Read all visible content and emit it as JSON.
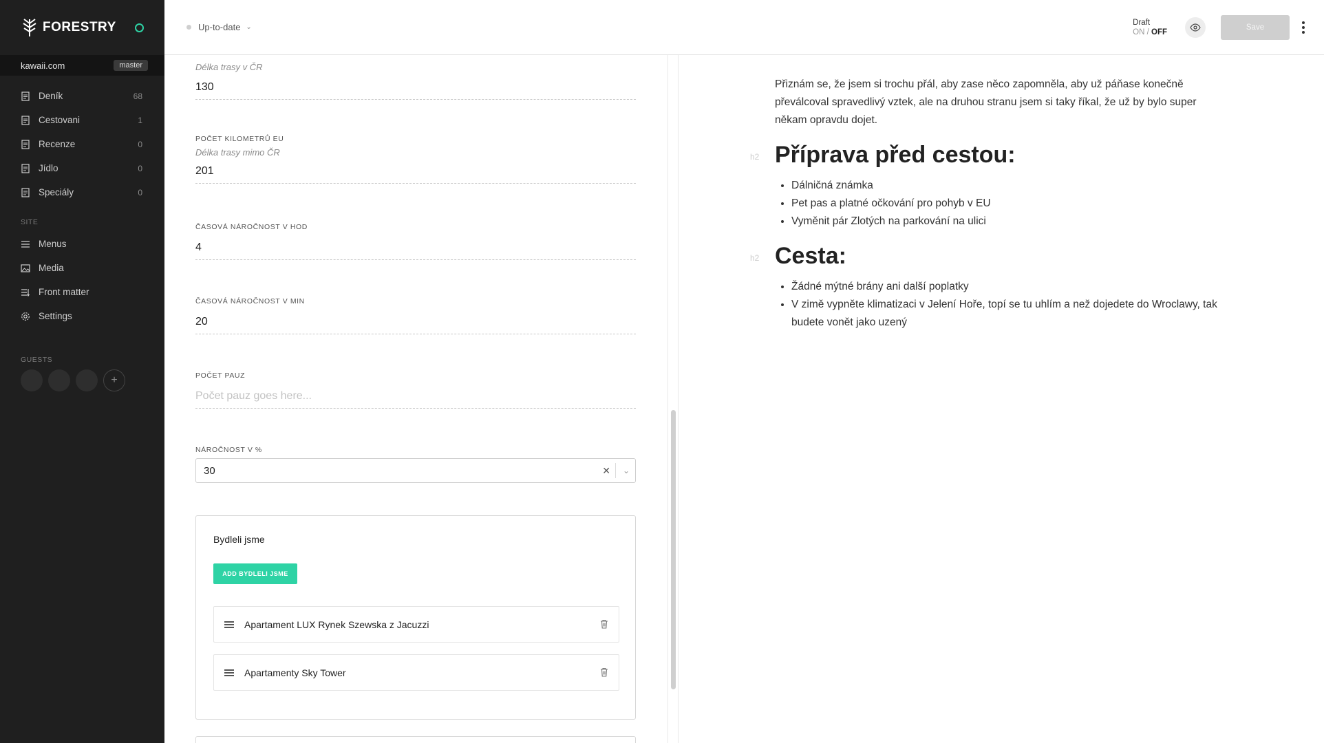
{
  "app": {
    "brand": "FORESTRY",
    "site": "kawaii.com",
    "branch": "master"
  },
  "sidebar": {
    "items": [
      {
        "label": "Deník",
        "count": "68",
        "icon": "document-icon"
      },
      {
        "label": "Cestovani",
        "count": "1",
        "icon": "document-icon"
      },
      {
        "label": "Recenze",
        "count": "0",
        "icon": "document-icon"
      },
      {
        "label": "Jídlo",
        "count": "0",
        "icon": "document-icon"
      },
      {
        "label": "Speciály",
        "count": "0",
        "icon": "document-icon"
      }
    ],
    "site_label": "SITE",
    "site_items": [
      {
        "label": "Menus",
        "icon": "menu-icon"
      },
      {
        "label": "Media",
        "icon": "image-icon"
      },
      {
        "label": "Front matter",
        "icon": "front-matter-icon"
      },
      {
        "label": "Settings",
        "icon": "gear-icon"
      }
    ],
    "guests_label": "GUESTS",
    "add_guest": "+"
  },
  "topbar": {
    "sync_status": "Up-to-date",
    "draft_label": "Draft",
    "draft_on": "ON",
    "draft_sep": "/",
    "draft_off": "OFF",
    "save_label": "Save"
  },
  "form": {
    "delka_cr": {
      "desc": "Délka trasy v ČR",
      "value": "130"
    },
    "km_eu": {
      "label": "POČET KILOMETRŮ EU",
      "desc": "Délka trasy mimo ČR",
      "value": "201"
    },
    "cas_hod": {
      "label": "ČASOVÁ NÁROČNOST V HOD",
      "value": "4"
    },
    "cas_min": {
      "label": "ČASOVÁ NÁROČNOST V MIN",
      "value": "20"
    },
    "pauzy": {
      "label": "POČET PAUZ",
      "placeholder": "Počet pauz goes here..."
    },
    "narocnost": {
      "label": "NÁROČNOST V %",
      "value": "30"
    },
    "bydleli": {
      "title": "Bydleli jsme",
      "add_label": "ADD BYDLELI JSME",
      "items": [
        "Apartament LUX Rynek Szewska z Jacuzzi",
        "Apartamenty Sky Tower"
      ]
    }
  },
  "preview": {
    "intro": "Přiznám se, že jsem si trochu přál, aby zase něco zapomněla, aby už páňase konečně převálcoval spravedlivý vztek, ale na druhou stranu jsem si taky říkal, že už by bylo super někam opravdu dojet.",
    "h2_tag": "h2",
    "heading1": "Příprava před cestou:",
    "list1": [
      "Dálničná známka",
      "Pet pas a platné očkování pro pohyb v EU",
      "Vyměnit pár Zlotých na parkování na ulici"
    ],
    "heading2": "Cesta:",
    "list2": [
      "Žádné mýtné brány ani další poplatky",
      "V zimě vypněte klimatizaci v Jelení Hoře, topí se tu uhlím a než dojedete do Wroclawy, tak budete vonět jako uzený"
    ]
  },
  "colors": {
    "accent": "#2ed3a5",
    "sidebar_bg": "#1f1f1f"
  }
}
